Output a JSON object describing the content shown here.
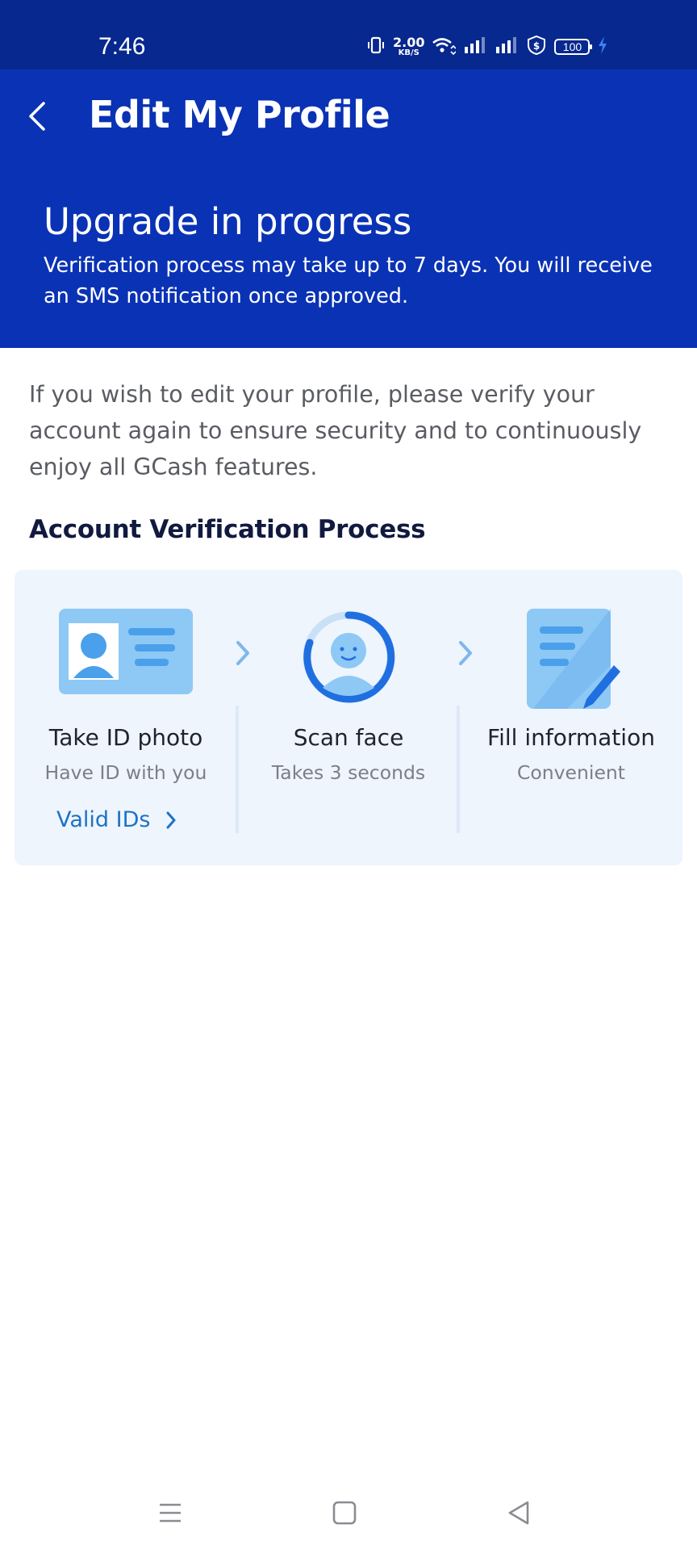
{
  "status_bar": {
    "time": "7:46",
    "net_speed_value": "2.00",
    "net_speed_unit": "KB/S",
    "battery": "100",
    "icons": [
      "vibrate-icon",
      "wifi-icon",
      "signal-icon",
      "signal-icon",
      "shield-dollar-icon",
      "battery-icon",
      "charging-icon"
    ]
  },
  "header": {
    "title": "Edit My Profile",
    "back_icon": "chevron-left-icon"
  },
  "banner": {
    "title": "Upgrade in progress",
    "description": "Verification process may take up to 7 days. You will receive an SMS notification once approved."
  },
  "intro": "If you wish to edit your profile, please verify your account again to ensure security and to continuously enjoy all GCash features.",
  "verification": {
    "title": "Account Verification Process",
    "steps": [
      {
        "title": "Take ID photo",
        "subtitle": "Have ID with you",
        "link": "Valid IDs",
        "icon": "id-card-icon"
      },
      {
        "title": "Scan face",
        "subtitle": "Takes 3 seconds",
        "icon": "face-scan-icon"
      },
      {
        "title": "Fill information",
        "subtitle": "Convenient",
        "icon": "form-edit-icon"
      }
    ]
  },
  "colors": {
    "status_bar": "#07288e",
    "header": "#0a32b5",
    "card": "#eef5fd",
    "link": "#1d72c5",
    "accent": "#1f6fe0"
  },
  "nav_bar": [
    "menu-icon",
    "home-icon",
    "back-icon"
  ]
}
